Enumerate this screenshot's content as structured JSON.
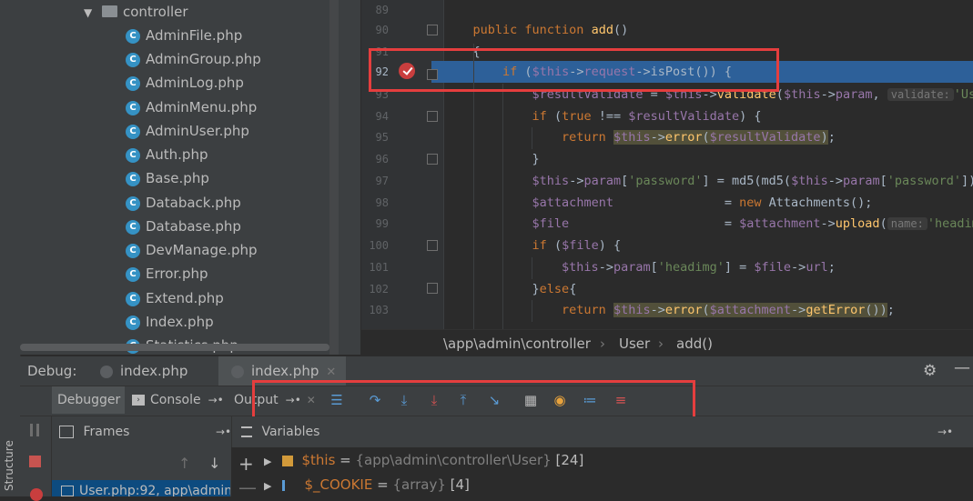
{
  "structure_label": "Structure",
  "project_tree": {
    "folder": "controller",
    "files": [
      "AdminFile.php",
      "AdminGroup.php",
      "AdminLog.php",
      "AdminMenu.php",
      "AdminUser.php",
      "Auth.php",
      "Base.php",
      "Databack.php",
      "Database.php",
      "DevManage.php",
      "Error.php",
      "Extend.php",
      "Index.php",
      "Statistics.php"
    ]
  },
  "editor": {
    "line_numbers": [
      "89",
      "90",
      "91",
      "92",
      "93",
      "94",
      "95",
      "96",
      "97",
      "98",
      "99",
      "100",
      "101",
      "102",
      "103"
    ],
    "current_line": "92",
    "hints": {
      "validate": "validate:",
      "name": "name:"
    }
  },
  "breadcrumb": {
    "path": "\\app\\admin\\controller",
    "class": "User",
    "method": "add()"
  },
  "debug": {
    "label": "Debug:",
    "tabs": [
      "index.php",
      "index.php"
    ],
    "sub_tabs": {
      "debugger": "Debugger",
      "console": "Console",
      "output": "Output"
    },
    "frames_title": "Frames",
    "variables_title": "Variables",
    "frame_item": "User.php:92, app\\admin",
    "variables": [
      {
        "name": "$this",
        "eq": " = ",
        "type": "{app\\admin\\controller\\User}",
        "count": " [24]"
      },
      {
        "name": "$_COOKIE",
        "eq": " = ",
        "type": "{array}",
        "count": " [4]"
      }
    ]
  },
  "colors": {
    "accent_red": "#e53e3e",
    "highlight_line": "#2d6099",
    "keyword": "#cc7832",
    "variable": "#9876aa",
    "function": "#ffc66d",
    "string": "#6a8759"
  }
}
